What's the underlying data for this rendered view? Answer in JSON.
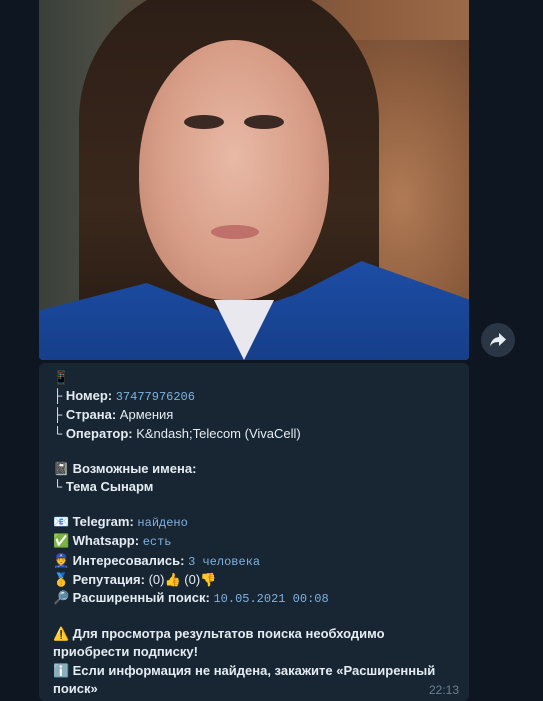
{
  "message": {
    "phone_emoji": "📱",
    "number_label": "├ Номер:",
    "number_value": "37477976206",
    "country_label": "├ Страна:",
    "country_value": "Армения",
    "operator_label": "└ Оператор:",
    "operator_value": "K&ndash;Telecom (VivaCell)",
    "names_emoji": "📓",
    "names_title": "Возможные имена:",
    "names_item": "└ Тема Сынарм",
    "telegram_label": "Telegram:",
    "telegram_value": "найдено",
    "whatsapp_label": "Whatsapp:",
    "whatsapp_value": "есть",
    "interested_label": "Интересовались:",
    "interested_value": "3 человека",
    "reputation_label": "Репутация:",
    "reputation_up_count": "(0)",
    "reputation_down_count": "(0)",
    "search_label": "Расширенный поиск:",
    "search_value": "10.05.2021 00:08",
    "warning_text": "Для просмотра результатов поиска необходимо приобрести подписку!",
    "info_text_prefix": "Если информация не найдена, закажите ",
    "info_text_bold": "«Расширенный поиск»",
    "time": "22:13"
  },
  "icons": {
    "forward": "forward-arrow-icon"
  },
  "colors": {
    "background": "#0e1621",
    "bubble": "#182533",
    "link": "#6ab2f2"
  }
}
